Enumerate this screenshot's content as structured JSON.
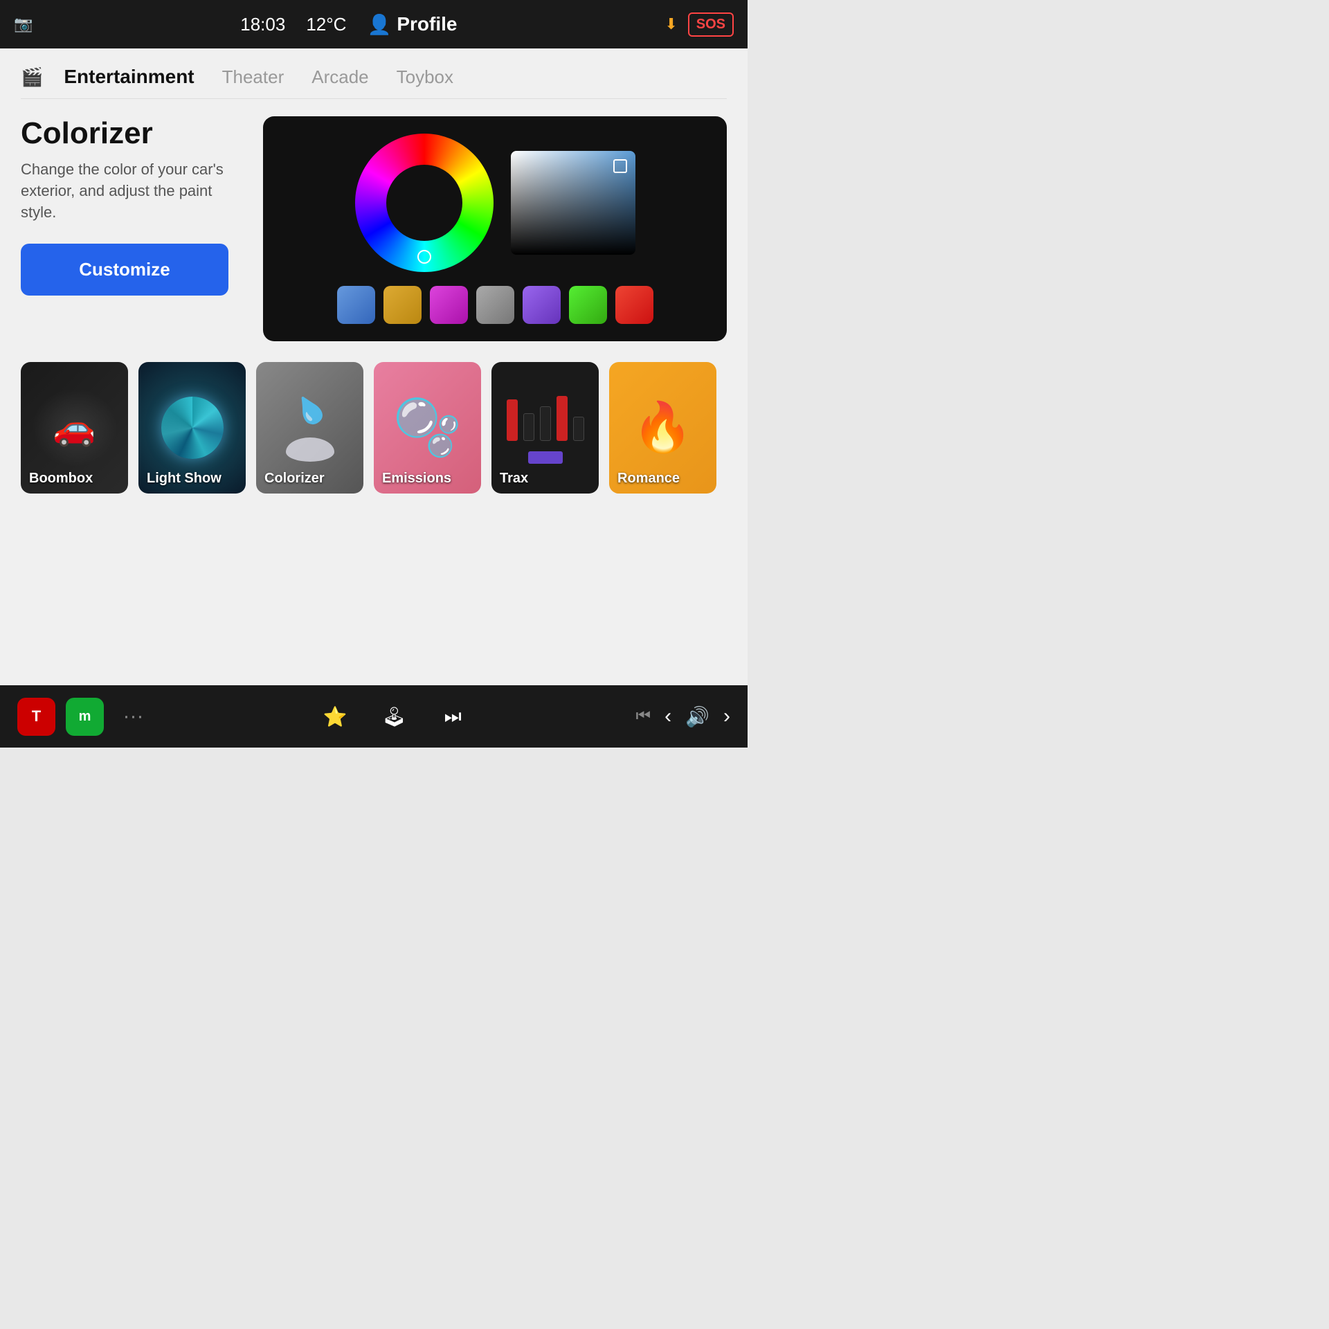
{
  "statusBar": {
    "time": "18:03",
    "temperature": "12°C",
    "profileLabel": "Profile",
    "sosLabel": "SOS"
  },
  "nav": {
    "icon": "🎬",
    "tabs": [
      {
        "label": "Entertainment",
        "active": true
      },
      {
        "label": "Theater",
        "active": false
      },
      {
        "label": "Arcade",
        "active": false
      },
      {
        "label": "Toybox",
        "active": false
      }
    ]
  },
  "colorizer": {
    "title": "Colorizer",
    "description": "Change the color of your car's exterior, and adjust the paint style.",
    "customizeLabel": "Customize"
  },
  "swatches": [
    {
      "color": "#5b8fd4",
      "label": "blue"
    },
    {
      "color": "#d4a020",
      "label": "gold"
    },
    {
      "color": "#cc44cc",
      "label": "purple"
    },
    {
      "color": "#888888",
      "label": "gray"
    },
    {
      "color": "#7744cc",
      "label": "violet"
    },
    {
      "color": "#44cc22",
      "label": "green"
    },
    {
      "color": "#cc3333",
      "label": "red"
    }
  ],
  "appCards": [
    {
      "id": "boombox",
      "label": "Boombox"
    },
    {
      "id": "lightshow",
      "label": "Light Show"
    },
    {
      "id": "colorizer",
      "label": "Colorizer"
    },
    {
      "id": "emissions",
      "label": "Emissions"
    },
    {
      "id": "trax",
      "label": "Trax"
    },
    {
      "id": "romance",
      "label": "Romance"
    }
  ],
  "taskbar": {
    "logoLabel": "T",
    "moreLabel": "···",
    "trophyLabel": "⭐",
    "joystickLabel": "🕹",
    "mediaLabel": "⏭",
    "prevLabel": "⏮"
  }
}
